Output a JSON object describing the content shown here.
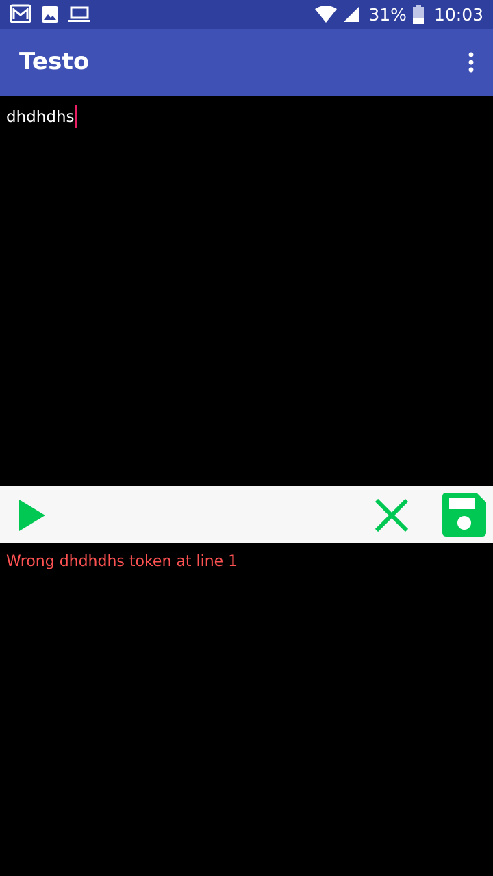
{
  "status_bar": {
    "battery": "31%",
    "time": "10:03",
    "icons": [
      "gmail-icon",
      "image-icon",
      "laptop-icon",
      "wifi-icon",
      "signal-icon",
      "battery-icon"
    ]
  },
  "app_bar": {
    "title": "Testo",
    "menu_icon": "more-vert-icon"
  },
  "editor": {
    "text": "dhdhdhs"
  },
  "toolbar": {
    "run_icon": "play-icon",
    "clear_icon": "close-icon",
    "save_icon": "save-icon",
    "accent_color": "#00c853"
  },
  "output": {
    "message": "Wrong dhdhdhs token at line 1",
    "color": "#ff5252"
  },
  "colors": {
    "status_bar": "#2f3f9e",
    "app_bar": "#3f51b5",
    "cursor": "#e91e63"
  }
}
